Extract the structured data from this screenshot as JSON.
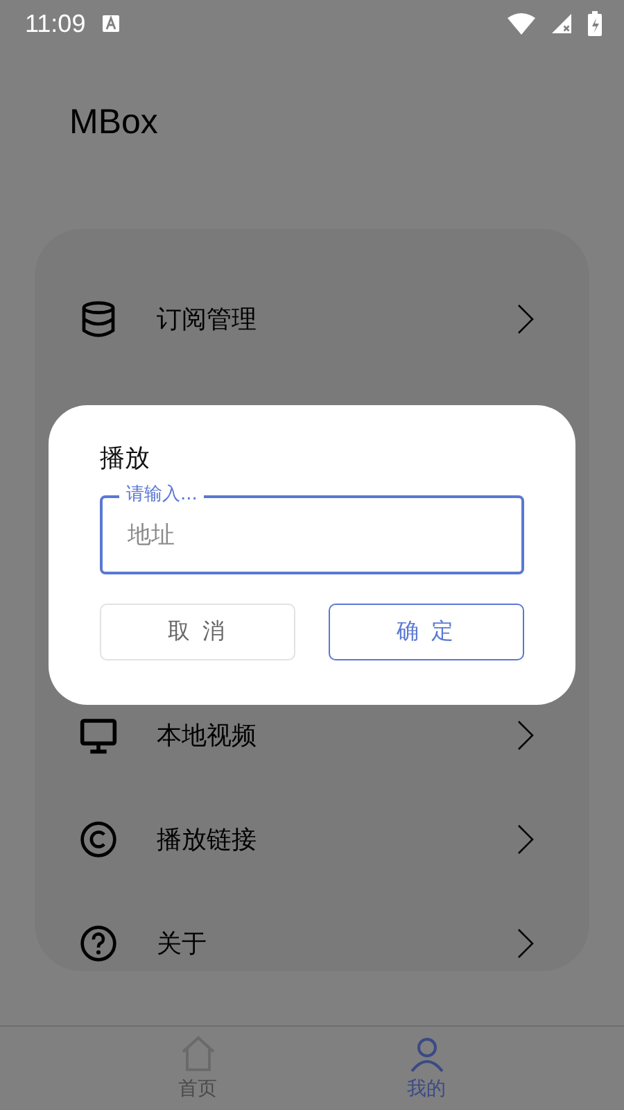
{
  "status_bar": {
    "time": "11:09"
  },
  "app_title": "MBox",
  "menu": [
    {
      "kind": "database",
      "label": "订阅管理"
    },
    {
      "kind": "hidden"
    },
    {
      "kind": "hidden"
    },
    {
      "kind": "hidden"
    },
    {
      "kind": "monitor",
      "label": "本地视频"
    },
    {
      "kind": "copyright",
      "label": "播放链接"
    },
    {
      "kind": "help",
      "label": "关于"
    }
  ],
  "bottom_nav": [
    {
      "kind": "home",
      "label": "首页",
      "selected": false
    },
    {
      "kind": "person",
      "label": "我的",
      "selected": true
    }
  ],
  "dialog": {
    "title": "播放",
    "field": {
      "label": "请输入...",
      "placeholder": "地址"
    },
    "buttons": [
      {
        "kind": "cancel",
        "label": "取 消"
      },
      {
        "kind": "confirm",
        "label": "确 定"
      }
    ]
  }
}
